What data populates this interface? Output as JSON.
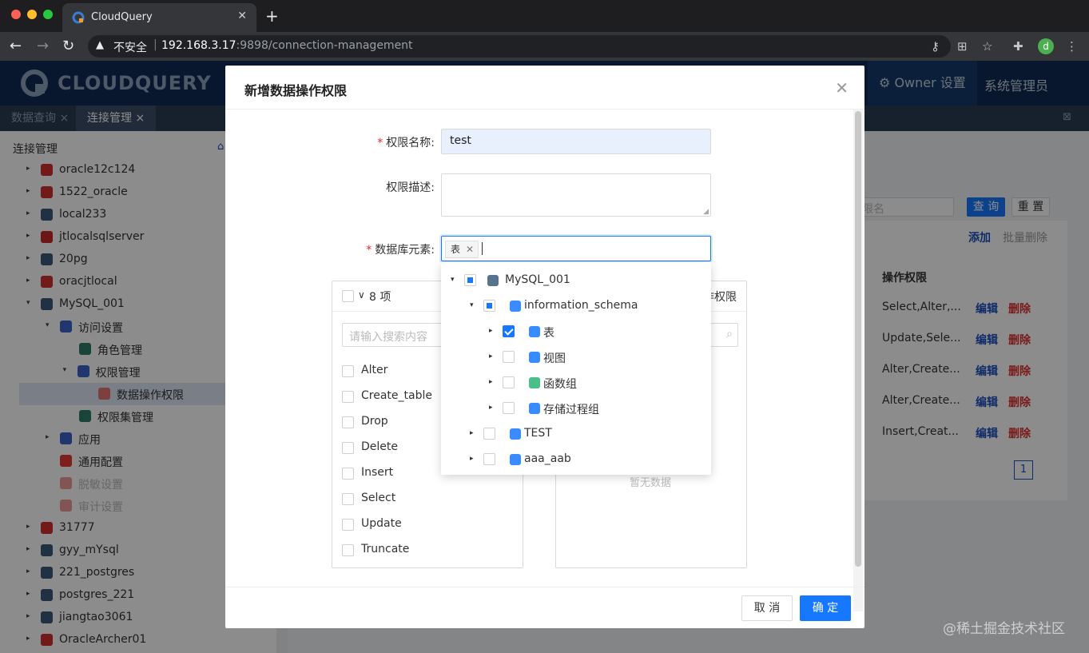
{
  "browser": {
    "tab_title": "CloudQuery",
    "insecure_label": "不安全",
    "url_host": "192.168.3.17",
    "url_rest": ":9898/connection-management",
    "profile_initial": "d"
  },
  "app": {
    "logo_text": "CLOUDQUERY",
    "nav": {
      "owner_settings": "Owner 设置",
      "sys_admin": "系统管理员"
    },
    "tabs": [
      {
        "label": "数据查询 ×"
      },
      {
        "label": "连接管理 ×"
      }
    ]
  },
  "sidebar": {
    "title": "连接管理",
    "items": [
      {
        "label": "oracle12c124",
        "icon": "oracle-icon",
        "color": "#d32f2f"
      },
      {
        "label": "1522_oracle",
        "icon": "oracle-icon",
        "color": "#d32f2f"
      },
      {
        "label": "local233",
        "icon": "mysql-icon",
        "color": "#3b5a7a"
      },
      {
        "label": "jtlocalsqlserver",
        "icon": "sqlserver-icon",
        "color": "#c62828"
      },
      {
        "label": "20pg",
        "icon": "postgres-icon",
        "color": "#3b5a7a"
      },
      {
        "label": "oracjtlocal",
        "icon": "oracle-icon",
        "color": "#d32f2f"
      },
      {
        "label": "MySQL_001",
        "icon": "mysql-icon",
        "color": "#3b5a7a"
      },
      {
        "label": "访问设置",
        "icon": "list-icon",
        "color": "#3a63c9"
      },
      {
        "label": "角色管理",
        "icon": "role-icon",
        "color": "#2e7d6b"
      },
      {
        "label": "权限管理",
        "icon": "list-icon",
        "color": "#3a63c9"
      },
      {
        "label": "数据操作权限",
        "icon": "db-permission-icon",
        "color": "#e57373"
      },
      {
        "label": "权限集管理",
        "icon": "permission-set-icon",
        "color": "#2e7d6b"
      },
      {
        "label": "应用",
        "icon": "list-icon",
        "color": "#3a63c9"
      },
      {
        "label": "通用配置",
        "icon": "gear-icon",
        "color": "#e53935"
      },
      {
        "label": "脱敏设置",
        "icon": "gear-icon",
        "color": "#ef9a9a"
      },
      {
        "label": "审计设置",
        "icon": "gear-icon",
        "color": "#ef9a9a"
      },
      {
        "label": "31777",
        "icon": "redis-icon",
        "color": "#d32f2f"
      },
      {
        "label": "gyy_mYsql",
        "icon": "mysql-icon",
        "color": "#3b5a7a"
      },
      {
        "label": "221_postgres",
        "icon": "postgres-icon",
        "color": "#3b5a7a"
      },
      {
        "label": "postgres_221",
        "icon": "postgres-icon",
        "color": "#3b5a7a"
      },
      {
        "label": "jiangtao3061",
        "icon": "mysql-icon",
        "color": "#3b5a7a"
      },
      {
        "label": "OracleArcher01",
        "icon": "oracle-icon",
        "color": "#d32f2f"
      }
    ]
  },
  "background": {
    "search_placeholder": "限名",
    "query_btn": "查 询",
    "reset_btn": "重 置",
    "add_link": "添加",
    "batch_delete": "批量删除",
    "col_header": "操作权限",
    "rows": [
      {
        "perm": "Select,Alter,...",
        "edit": "编辑",
        "del": "删除"
      },
      {
        "perm": "Update,Sele...",
        "edit": "编辑",
        "del": "删除"
      },
      {
        "perm": "Alter,Create...",
        "edit": "编辑",
        "del": "删除"
      },
      {
        "perm": "Alter,Create...",
        "edit": "编辑",
        "del": "删除"
      },
      {
        "perm": "Insert,Creat...",
        "edit": "编辑",
        "del": "删除"
      }
    ],
    "page": "1",
    "watermark": "@稀土掘金技术社区"
  },
  "modal": {
    "title": "新增数据操作权限",
    "name_label": "权限名称:",
    "name_value": "test",
    "desc_label": "权限描述:",
    "desc_value": "",
    "elements_label": "数据库元素:",
    "selected_tag": "表",
    "left_panel": {
      "count": "8 项",
      "search_placeholder": "请输入搜索内容",
      "items": [
        "Alter",
        "Create_table",
        "Drop",
        "Delete",
        "Insert",
        "Select",
        "Update",
        "Truncate"
      ]
    },
    "right_panel": {
      "header_fragment": "作权限",
      "empty_text": "暂无数据"
    },
    "tree": [
      {
        "label": "MySQL_001",
        "state": "partial",
        "icon": "mysql-icon"
      },
      {
        "label": "information_schema",
        "state": "partial",
        "icon": "database-icon"
      },
      {
        "label": "表",
        "state": "checked",
        "icon": "table-icon"
      },
      {
        "label": "视图",
        "state": "unchecked",
        "icon": "view-icon"
      },
      {
        "label": "函数组",
        "state": "unchecked",
        "icon": "function-group-icon"
      },
      {
        "label": "存储过程组",
        "state": "unchecked",
        "icon": "procedure-group-icon"
      },
      {
        "label": "TEST",
        "state": "unchecked",
        "icon": "database-icon"
      },
      {
        "label": "aaa_aab",
        "state": "unchecked",
        "icon": "database-icon"
      }
    ],
    "cancel_label": "取 消",
    "ok_label": "确 定"
  }
}
